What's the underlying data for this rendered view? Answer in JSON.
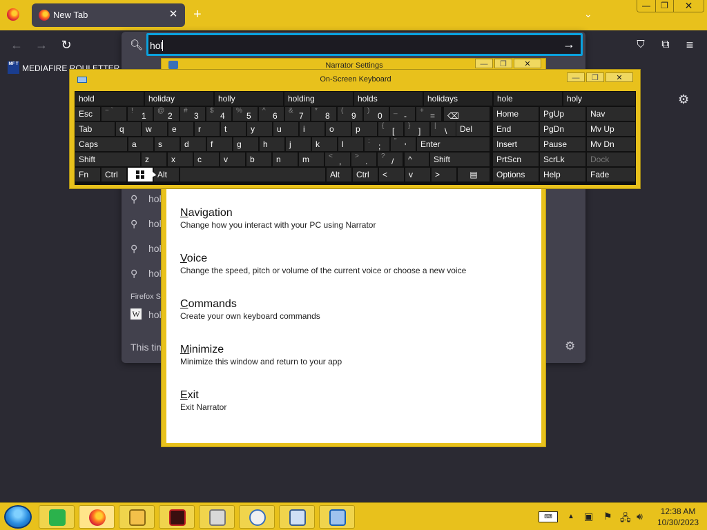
{
  "browser": {
    "tab_title": "New Tab",
    "tab_close": "✕",
    "new_tab": "+",
    "tab_list": "⌄",
    "window_controls": {
      "minimize": "—",
      "maximize": "❐",
      "close": "✕"
    },
    "url_value": "hol",
    "url_go": "→",
    "bookmark_label": "MEDIAFIRE ROULETTER",
    "bookmark_icon_text": "MF T",
    "suggestions": [
      "hol",
      "hol",
      "hol",
      "hol"
    ],
    "firefox_suggest_label": "Firefox S",
    "wiki_suggestion": "hol",
    "this_time_text": "This tim"
  },
  "narrator": {
    "title": "Narrator Settings",
    "items": [
      {
        "access_key": "N",
        "rest": "avigation",
        "desc": "Change how you interact with your PC using Narrator"
      },
      {
        "access_key": "V",
        "rest": "oice",
        "desc": "Change the speed, pitch or volume of the current voice or choose a new voice"
      },
      {
        "access_key": "C",
        "rest": "ommands",
        "desc": "Create your own keyboard commands"
      },
      {
        "access_key": "M",
        "rest": "inimize",
        "desc": "Minimize this window and return to your app"
      },
      {
        "access_key": "E",
        "rest": "xit",
        "desc": "Exit Narrator"
      }
    ]
  },
  "osk": {
    "title": "On-Screen Keyboard",
    "predictions": [
      "hold",
      "holiday",
      "holly",
      "holding",
      "holds",
      "holidays",
      "hole",
      "holy"
    ],
    "row1": {
      "esc": "Esc",
      "backspace": "⌫"
    },
    "row1_keys": [
      {
        "s": "~ `",
        "m": ""
      },
      {
        "s": "!",
        "m": "1"
      },
      {
        "s": "@",
        "m": "2"
      },
      {
        "s": "#",
        "m": "3"
      },
      {
        "s": "$",
        "m": "4"
      },
      {
        "s": "%",
        "m": "5"
      },
      {
        "s": "^",
        "m": "6"
      },
      {
        "s": "&",
        "m": "7"
      },
      {
        "s": "*",
        "m": "8"
      },
      {
        "s": "(",
        "m": "9"
      },
      {
        "s": ")",
        "m": "0"
      },
      {
        "s": "_",
        "m": "-"
      },
      {
        "s": "+",
        "m": "="
      }
    ],
    "row2_tab": "Tab",
    "row2_letters": [
      "q",
      "w",
      "e",
      "r",
      "t",
      "y",
      "u",
      "i",
      "o",
      "p"
    ],
    "row2_extra": [
      {
        "s": "{",
        "m": "["
      },
      {
        "s": "}",
        "m": "]"
      },
      {
        "s": "|",
        "m": "\\"
      }
    ],
    "row2_del": "Del",
    "row3_caps": "Caps",
    "row3_letters": [
      "a",
      "s",
      "d",
      "f",
      "g",
      "h",
      "j",
      "k",
      "l"
    ],
    "row3_extra": [
      {
        "s": ":",
        "m": ";"
      },
      {
        "s": "\"",
        "m": "'"
      }
    ],
    "row3_enter": "Enter",
    "row4_shift": "Shift",
    "row4_letters": [
      "z",
      "x",
      "c",
      "v",
      "b",
      "n",
      "m"
    ],
    "row4_extra": [
      {
        "s": "<",
        "m": ","
      },
      {
        "s": ">",
        "m": "."
      },
      {
        "s": "?",
        "m": "/"
      }
    ],
    "row4_up": "^",
    "row5": {
      "fn": "Fn",
      "ctrl": "Ctrl",
      "alt": "Alt",
      "alt_r": "Alt",
      "ctrl_r": "Ctrl",
      "left": "<",
      "down": "v",
      "right": ">",
      "menu": "▤"
    },
    "nav_keys": [
      [
        "Home",
        "PgUp",
        "Nav"
      ],
      [
        "End",
        "PgDn",
        "Mv Up"
      ],
      [
        "Insert",
        "Pause",
        "Mv Dn"
      ],
      [
        "PrtScn",
        "ScrLk",
        "Dock"
      ],
      [
        "Options",
        "Help",
        "Fade"
      ]
    ]
  },
  "taskbar": {
    "clock_time": "12:38 AM",
    "clock_date": "10/30/2023",
    "tray_up": "▲"
  },
  "colors": {
    "accent": "#e8c11c",
    "focus": "#0aa2df",
    "page_bg": "#2b2a33"
  }
}
